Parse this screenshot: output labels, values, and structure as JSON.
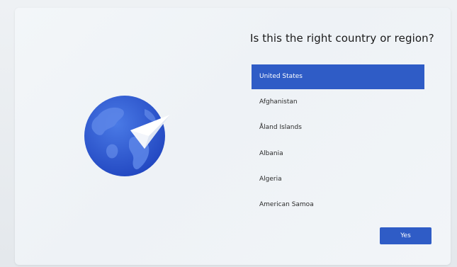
{
  "setup": {
    "title": "Is this the right country or region?",
    "countries": [
      {
        "label": "United States",
        "selected": true
      },
      {
        "label": "Afghanistan",
        "selected": false
      },
      {
        "label": "Åland Islands",
        "selected": false
      },
      {
        "label": "Albania",
        "selected": false
      },
      {
        "label": "Algeria",
        "selected": false
      },
      {
        "label": "American Samoa",
        "selected": false
      }
    ],
    "yes_label": "Yes"
  },
  "colors": {
    "accent": "#2f5cc6",
    "globe_dark": "#2e52c8",
    "globe_land": "#4f7be0"
  },
  "icons": {
    "illustration": "globe-with-paper-plane-icon"
  }
}
